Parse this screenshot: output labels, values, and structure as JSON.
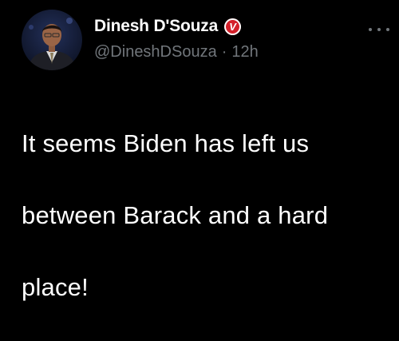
{
  "user": {
    "display_name": "Dinesh D'Souza",
    "handle": "@DineshDSouza",
    "separator": "·",
    "timestamp": "12h",
    "badge_letter": "V",
    "avatar_icon": "profile-photo"
  },
  "menu": {
    "icon": "more-horizontal-icon"
  },
  "tweet": {
    "lines": [
      "It seems Biden has left us",
      "between Barack and a hard",
      "place!"
    ]
  },
  "colors": {
    "background": "#000000",
    "primary_text": "#ffffff",
    "secondary_text": "#71767b",
    "badge": "#d4202a"
  }
}
